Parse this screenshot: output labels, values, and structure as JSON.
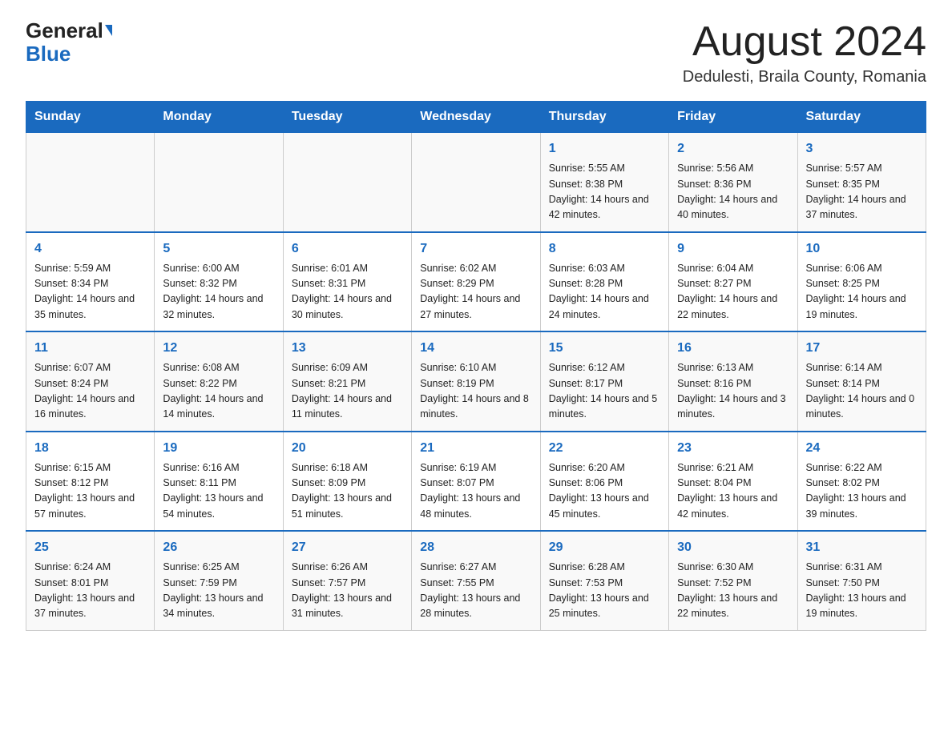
{
  "logo": {
    "general": "General",
    "blue": "Blue",
    "triangle": "▶"
  },
  "title": "August 2024",
  "location": "Dedulesti, Braila County, Romania",
  "days_of_week": [
    "Sunday",
    "Monday",
    "Tuesday",
    "Wednesday",
    "Thursday",
    "Friday",
    "Saturday"
  ],
  "weeks": [
    {
      "days": [
        {
          "number": "",
          "info": ""
        },
        {
          "number": "",
          "info": ""
        },
        {
          "number": "",
          "info": ""
        },
        {
          "number": "",
          "info": ""
        },
        {
          "number": "1",
          "info": "Sunrise: 5:55 AM\nSunset: 8:38 PM\nDaylight: 14 hours and 42 minutes."
        },
        {
          "number": "2",
          "info": "Sunrise: 5:56 AM\nSunset: 8:36 PM\nDaylight: 14 hours and 40 minutes."
        },
        {
          "number": "3",
          "info": "Sunrise: 5:57 AM\nSunset: 8:35 PM\nDaylight: 14 hours and 37 minutes."
        }
      ]
    },
    {
      "days": [
        {
          "number": "4",
          "info": "Sunrise: 5:59 AM\nSunset: 8:34 PM\nDaylight: 14 hours and 35 minutes."
        },
        {
          "number": "5",
          "info": "Sunrise: 6:00 AM\nSunset: 8:32 PM\nDaylight: 14 hours and 32 minutes."
        },
        {
          "number": "6",
          "info": "Sunrise: 6:01 AM\nSunset: 8:31 PM\nDaylight: 14 hours and 30 minutes."
        },
        {
          "number": "7",
          "info": "Sunrise: 6:02 AM\nSunset: 8:29 PM\nDaylight: 14 hours and 27 minutes."
        },
        {
          "number": "8",
          "info": "Sunrise: 6:03 AM\nSunset: 8:28 PM\nDaylight: 14 hours and 24 minutes."
        },
        {
          "number": "9",
          "info": "Sunrise: 6:04 AM\nSunset: 8:27 PM\nDaylight: 14 hours and 22 minutes."
        },
        {
          "number": "10",
          "info": "Sunrise: 6:06 AM\nSunset: 8:25 PM\nDaylight: 14 hours and 19 minutes."
        }
      ]
    },
    {
      "days": [
        {
          "number": "11",
          "info": "Sunrise: 6:07 AM\nSunset: 8:24 PM\nDaylight: 14 hours and 16 minutes."
        },
        {
          "number": "12",
          "info": "Sunrise: 6:08 AM\nSunset: 8:22 PM\nDaylight: 14 hours and 14 minutes."
        },
        {
          "number": "13",
          "info": "Sunrise: 6:09 AM\nSunset: 8:21 PM\nDaylight: 14 hours and 11 minutes."
        },
        {
          "number": "14",
          "info": "Sunrise: 6:10 AM\nSunset: 8:19 PM\nDaylight: 14 hours and 8 minutes."
        },
        {
          "number": "15",
          "info": "Sunrise: 6:12 AM\nSunset: 8:17 PM\nDaylight: 14 hours and 5 minutes."
        },
        {
          "number": "16",
          "info": "Sunrise: 6:13 AM\nSunset: 8:16 PM\nDaylight: 14 hours and 3 minutes."
        },
        {
          "number": "17",
          "info": "Sunrise: 6:14 AM\nSunset: 8:14 PM\nDaylight: 14 hours and 0 minutes."
        }
      ]
    },
    {
      "days": [
        {
          "number": "18",
          "info": "Sunrise: 6:15 AM\nSunset: 8:12 PM\nDaylight: 13 hours and 57 minutes."
        },
        {
          "number": "19",
          "info": "Sunrise: 6:16 AM\nSunset: 8:11 PM\nDaylight: 13 hours and 54 minutes."
        },
        {
          "number": "20",
          "info": "Sunrise: 6:18 AM\nSunset: 8:09 PM\nDaylight: 13 hours and 51 minutes."
        },
        {
          "number": "21",
          "info": "Sunrise: 6:19 AM\nSunset: 8:07 PM\nDaylight: 13 hours and 48 minutes."
        },
        {
          "number": "22",
          "info": "Sunrise: 6:20 AM\nSunset: 8:06 PM\nDaylight: 13 hours and 45 minutes."
        },
        {
          "number": "23",
          "info": "Sunrise: 6:21 AM\nSunset: 8:04 PM\nDaylight: 13 hours and 42 minutes."
        },
        {
          "number": "24",
          "info": "Sunrise: 6:22 AM\nSunset: 8:02 PM\nDaylight: 13 hours and 39 minutes."
        }
      ]
    },
    {
      "days": [
        {
          "number": "25",
          "info": "Sunrise: 6:24 AM\nSunset: 8:01 PM\nDaylight: 13 hours and 37 minutes."
        },
        {
          "number": "26",
          "info": "Sunrise: 6:25 AM\nSunset: 7:59 PM\nDaylight: 13 hours and 34 minutes."
        },
        {
          "number": "27",
          "info": "Sunrise: 6:26 AM\nSunset: 7:57 PM\nDaylight: 13 hours and 31 minutes."
        },
        {
          "number": "28",
          "info": "Sunrise: 6:27 AM\nSunset: 7:55 PM\nDaylight: 13 hours and 28 minutes."
        },
        {
          "number": "29",
          "info": "Sunrise: 6:28 AM\nSunset: 7:53 PM\nDaylight: 13 hours and 25 minutes."
        },
        {
          "number": "30",
          "info": "Sunrise: 6:30 AM\nSunset: 7:52 PM\nDaylight: 13 hours and 22 minutes."
        },
        {
          "number": "31",
          "info": "Sunrise: 6:31 AM\nSunset: 7:50 PM\nDaylight: 13 hours and 19 minutes."
        }
      ]
    }
  ]
}
